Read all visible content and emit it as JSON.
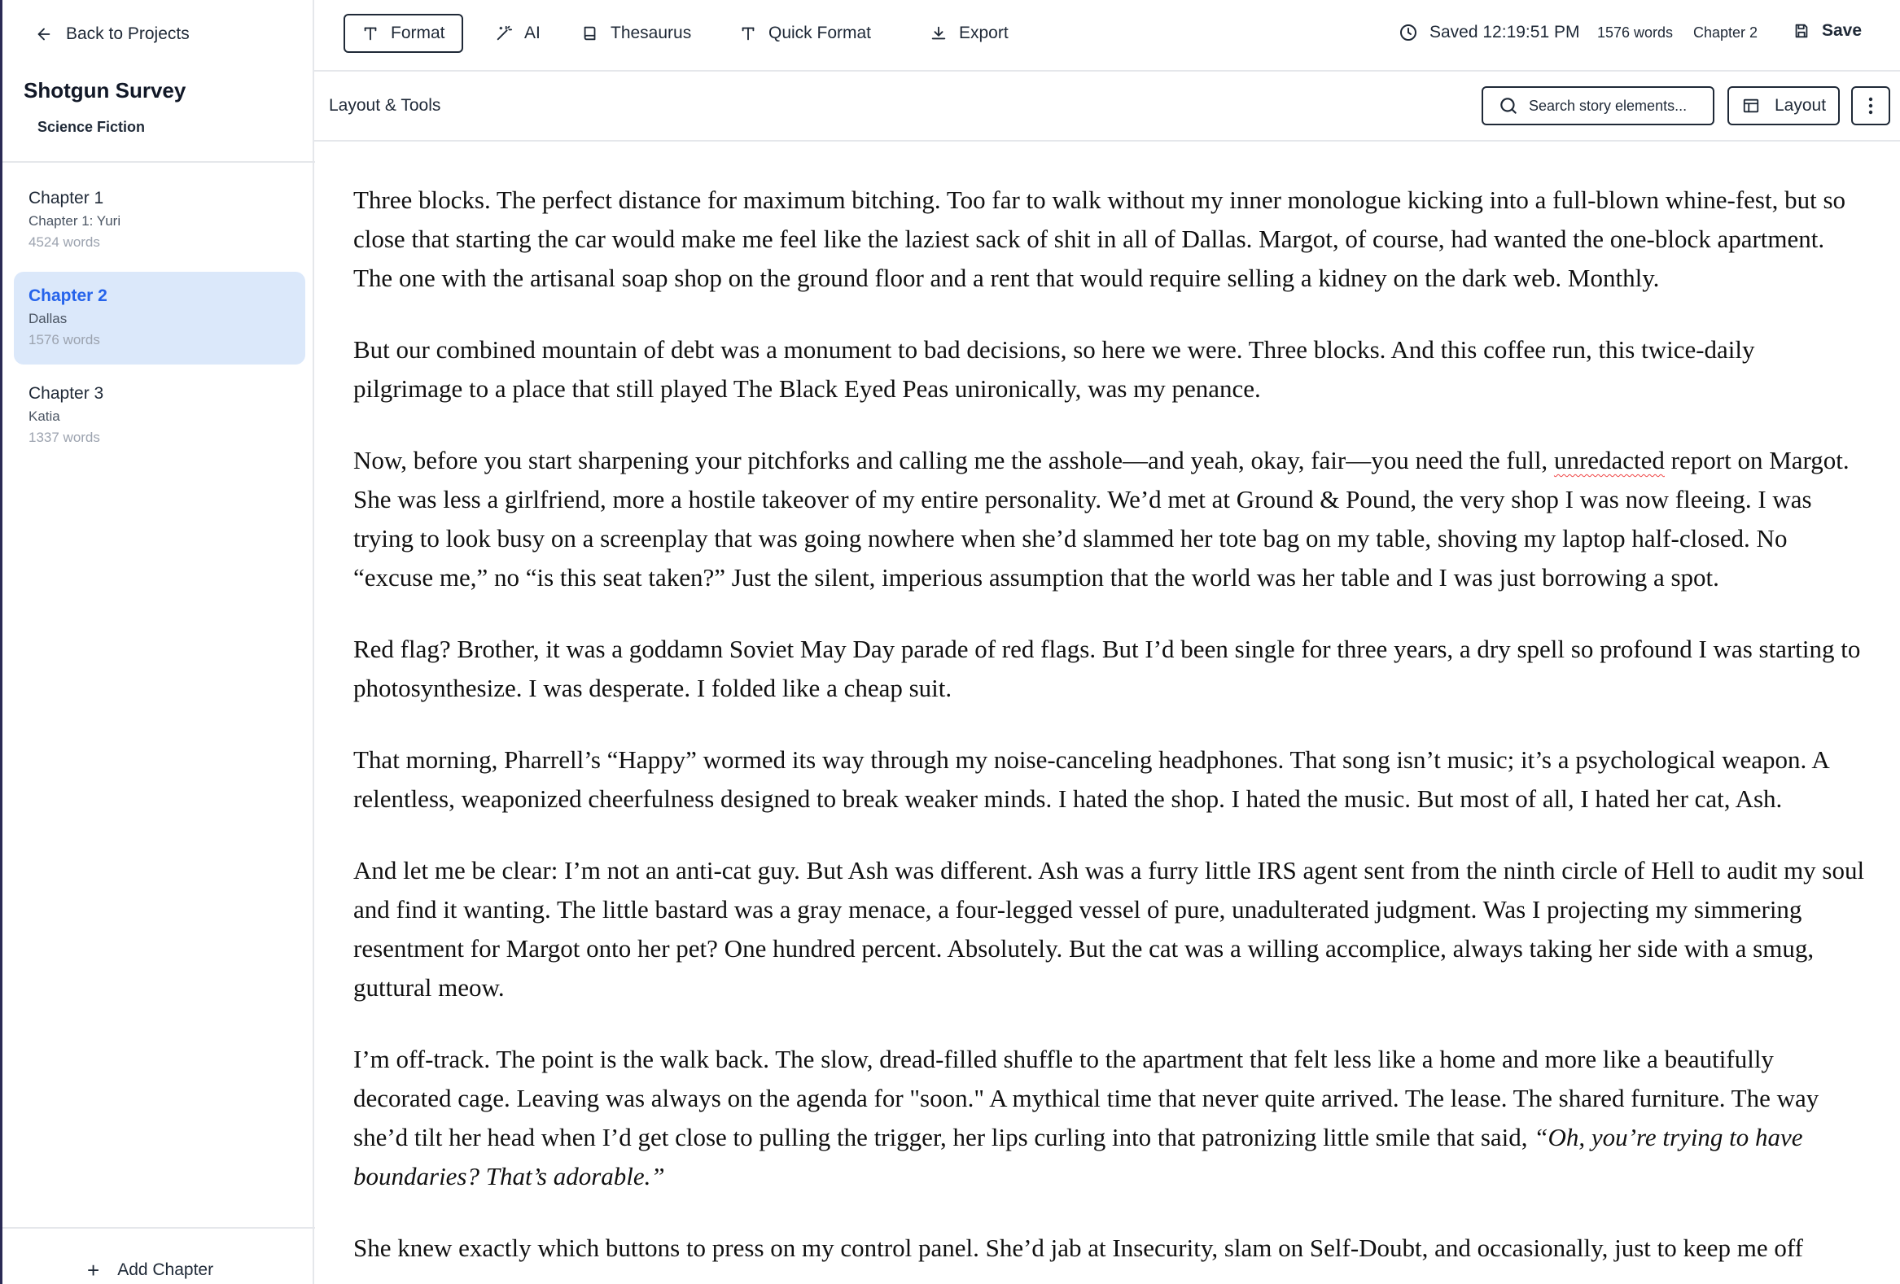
{
  "sidebar": {
    "back_label": "Back to Projects",
    "project_title": "Shotgun Survey",
    "genre": "Science Fiction",
    "chapters": [
      {
        "title": "Chapter 1",
        "subtitle": "Chapter 1: Yuri",
        "words": "4524 words"
      },
      {
        "title": "Chapter 2",
        "subtitle": "Dallas",
        "words": "1576 words"
      },
      {
        "title": "Chapter 3",
        "subtitle": "Katia",
        "words": "1337 words"
      }
    ],
    "add_chapter_label": "Add Chapter"
  },
  "topbar": {
    "format_label": "Format",
    "ai_label": "AI",
    "thesaurus_label": "Thesaurus",
    "quick_format_label": "Quick Format",
    "export_label": "Export",
    "saved_status": "Saved 12:19:51 PM",
    "word_count": "1576 words",
    "chapter_label": "Chapter 2",
    "save_label": "Save"
  },
  "toolbar2": {
    "layout_tools_label": "Layout & Tools",
    "search_placeholder": "Search story elements...",
    "layout_label": "Layout"
  },
  "editor": {
    "p1": "Three blocks. The perfect distance for maximum bitching. Too far to walk without my inner monologue kicking into a full-blown whine-fest, but so close that starting the car would make me feel like the laziest sack of shit in all of Dallas. Margot, of course, had wanted the one-block apartment. The one with the artisanal soap shop on the ground floor and a rent that would require selling a kidney on the dark web. Monthly.",
    "p2": "But our combined mountain of debt was a monument to bad decisions, so here we were. Three blocks. And this coffee run, this twice-daily pilgrimage to a place that still played The Black Eyed Peas unironically, was my penance.",
    "p3_a": "Now, before you start sharpening your pitchforks and calling me the asshole—and yeah, okay, fair—you need the full, ",
    "p3_spell": "unredacted",
    "p3_b": " report on Margot. She was less a girlfriend, more a hostile takeover of my entire personality. We’d met at Ground & Pound, the very shop I was now fleeing. I was trying to look busy on a screenplay that was going nowhere when she’d slammed her tote bag on my table, shoving my laptop half-closed. No “excuse me,” no “is this seat taken?” Just the silent, imperious assumption that the world was her table and I was just borrowing a spot.",
    "p4": "Red flag? Brother, it was a goddamn Soviet May Day parade of red flags. But I’d been single for three years, a dry spell so profound I was starting to photosynthesize. I was desperate. I folded like a cheap suit.",
    "p5": "That morning, Pharrell’s “Happy” wormed its way through my noise-canceling headphones. That song isn’t music; it’s a psychological weapon. A relentless, weaponized cheerfulness designed to break weaker minds. I hated the shop. I hated the music. But most of all, I hated her cat, Ash.",
    "p6": "And let me be clear: I’m not an anti-cat guy. But Ash was different. Ash was a furry little IRS agent sent from the ninth circle of Hell to audit my soul and find it wanting. The little bastard was a gray menace, a four-legged vessel of pure, unadulterated judgment. Was I projecting my simmering resentment for Margot onto her pet? One hundred percent. Absolutely. But the cat was a willing accomplice, always taking her side with a smug, guttural meow.",
    "p7_a": "I’m off-track. The point is the walk back. The slow, dread-filled shuffle to the apartment that felt less like a home and more like a beautifully decorated cage. Leaving was always on the agenda for \"soon.\" A mythical time that never quite arrived. The lease. The shared furniture. The way she’d tilt her head when I’d get close to pulling the trigger, her lips curling into that patronizing little smile that said, ",
    "p7_italic": "“Oh, you’re trying to have boundaries? That’s adorable.”",
    "p8": "She knew exactly which buttons to press on my control panel. She’d jab at Insecurity, slam on Self-Doubt, and occasionally, just to keep me off"
  },
  "colors": {
    "accent": "#2563eb",
    "active_chapter_bg": "#dbe8fa",
    "sidebar_left_border": "#2b2b55"
  }
}
